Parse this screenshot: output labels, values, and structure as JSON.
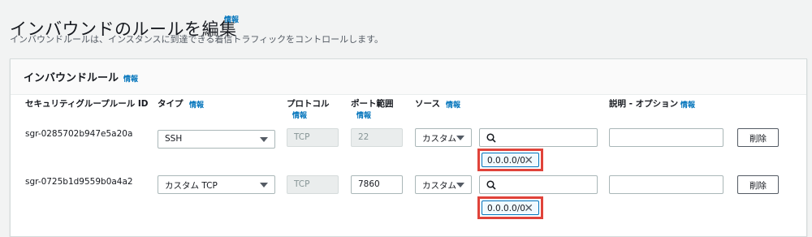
{
  "page": {
    "title": "インバウンドのルールを編集",
    "title_info": "情報",
    "description": "インバウンドルールは、インスタンスに到達できる着信トラフィックをコントロールします。"
  },
  "panel": {
    "title": "インバウンドルール",
    "info": "情報",
    "columns": {
      "rule_id": "セキュリティグループルール ID",
      "type": "タイプ",
      "type_info": "情報",
      "protocol": "プロトコル",
      "protocol_info": "情報",
      "port": "ポート範囲",
      "port_info": "情報",
      "source": "ソース",
      "source_info": "情報",
      "description": "説明 - オプション",
      "description_info": "情報"
    },
    "rules": [
      {
        "id": "sgr-0285702b947e5a20a",
        "type": "SSH",
        "protocol": "TCP",
        "port": "22",
        "source_type": "カスタム",
        "search_value": "",
        "cidr": "0.0.0.0/0",
        "description": "",
        "delete_label": "削除"
      },
      {
        "id": "sgr-0725b1d9559b0a4a2",
        "type": "カスタム TCP",
        "protocol": "TCP",
        "port": "7860",
        "source_type": "カスタム",
        "search_value": "",
        "cidr": "0.0.0.0/0",
        "description": "",
        "delete_label": "削除"
      }
    ]
  },
  "colors": {
    "link": "#0073bb",
    "highlight": "#e0433a",
    "token_bg": "#f1faff"
  }
}
